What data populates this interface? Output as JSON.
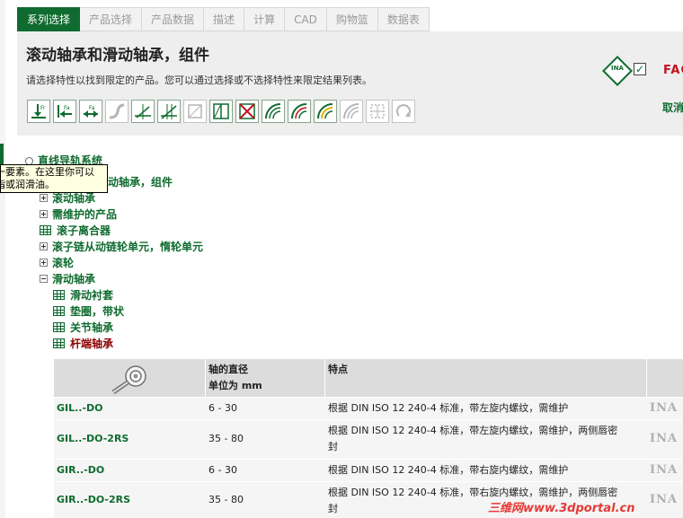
{
  "tabs": [
    "系列选择",
    "产品选择",
    "产品数据",
    "描述",
    "计算",
    "CAD",
    "购物篮",
    "数据表"
  ],
  "header": {
    "title": "滚动轴承和滑动轴承，组件",
    "description": "请选择特性以找到限定的产品。您可以通过选择或不选择特性来限定结果列表。",
    "brand_ina": "INA",
    "brand_fag": "FAG",
    "checkbox_mark": "✓",
    "cancel": "取消"
  },
  "filter_icons": [
    {
      "icon": "radial-load-icon",
      "sub": "Fr",
      "enabled": true
    },
    {
      "icon": "axial-load-left-icon",
      "sub": "Fa",
      "enabled": true
    },
    {
      "icon": "axial-load-both-icon",
      "sub": "Fa",
      "enabled": true
    },
    {
      "icon": "flexible-shaft-icon",
      "enabled": false
    },
    {
      "icon": "angle-misalignment-icon",
      "enabled": true
    },
    {
      "icon": "angle-misalignment-2-icon",
      "enabled": true
    },
    {
      "icon": "square-frame-icon",
      "enabled": false
    },
    {
      "icon": "split-bearing-icon",
      "enabled": true
    },
    {
      "icon": "crossed-box-icon",
      "enabled": true
    },
    {
      "icon": "speed-arc-icon",
      "enabled": true
    },
    {
      "icon": "speed-arc-2-icon",
      "enabled": true
    },
    {
      "icon": "speed-arc-yellow-icon",
      "enabled": true
    },
    {
      "icon": "speed-arc-gray-icon",
      "enabled": false
    },
    {
      "icon": "grid-frame-icon",
      "enabled": false
    },
    {
      "icon": "rotation-arrow-icon",
      "enabled": false
    }
  ],
  "tree": {
    "root": "直线导轨系统",
    "level1": "动轴承，组件",
    "items": [
      {
        "label": "滚动轴承",
        "type": "plus"
      },
      {
        "label": "需维护的产品",
        "type": "plus"
      },
      {
        "label": "滚子离合器",
        "type": "grid"
      },
      {
        "label": "滚子链从动链轮单元，惰轮单元",
        "type": "plus"
      },
      {
        "label": "滚轮",
        "type": "plus"
      },
      {
        "label": "滑动轴承",
        "type": "minus"
      }
    ],
    "children": [
      {
        "label": "滑动衬套",
        "selected": false
      },
      {
        "label": "垫圈，带状",
        "selected": false
      },
      {
        "label": "关节轴承",
        "selected": false
      },
      {
        "label": "杆端轴承",
        "selected": true
      }
    ]
  },
  "tooltip": {
    "line1": "一要素。在这里你可以",
    "line2": "脂或润滑油。"
  },
  "table": {
    "headers": {
      "diameter_line1": "轴的直径",
      "diameter_line2": "单位为 mm",
      "feature": "特点"
    },
    "rows": [
      {
        "code": "GIL..-DO",
        "diameter": "6 - 30",
        "feature": "根据 DIN ISO 12 240-4 标准，带左旋内螺纹，需维护",
        "feature2": "",
        "brand": "INA"
      },
      {
        "code": "GIL..-DO-2RS",
        "diameter": "35 - 80",
        "feature": "根据 DIN ISO 12 240-4 标准，带左旋内螺纹，需维护，两侧唇密",
        "feature2": "封",
        "brand": "INA"
      },
      {
        "code": "GIR..-DO",
        "diameter": "6 - 30",
        "feature": "根据 DIN ISO 12 240-4 标准，带右旋内螺纹，需维护",
        "feature2": "",
        "brand": "INA"
      },
      {
        "code": "GIR..-DO-2RS",
        "diameter": "35 - 80",
        "feature": "根据 DIN ISO 12 240-4 标准，带右旋内螺纹，需维护，两侧唇密",
        "feature2": "封",
        "brand": "INA"
      }
    ]
  },
  "watermark": "三维网www.3dportal.cn"
}
